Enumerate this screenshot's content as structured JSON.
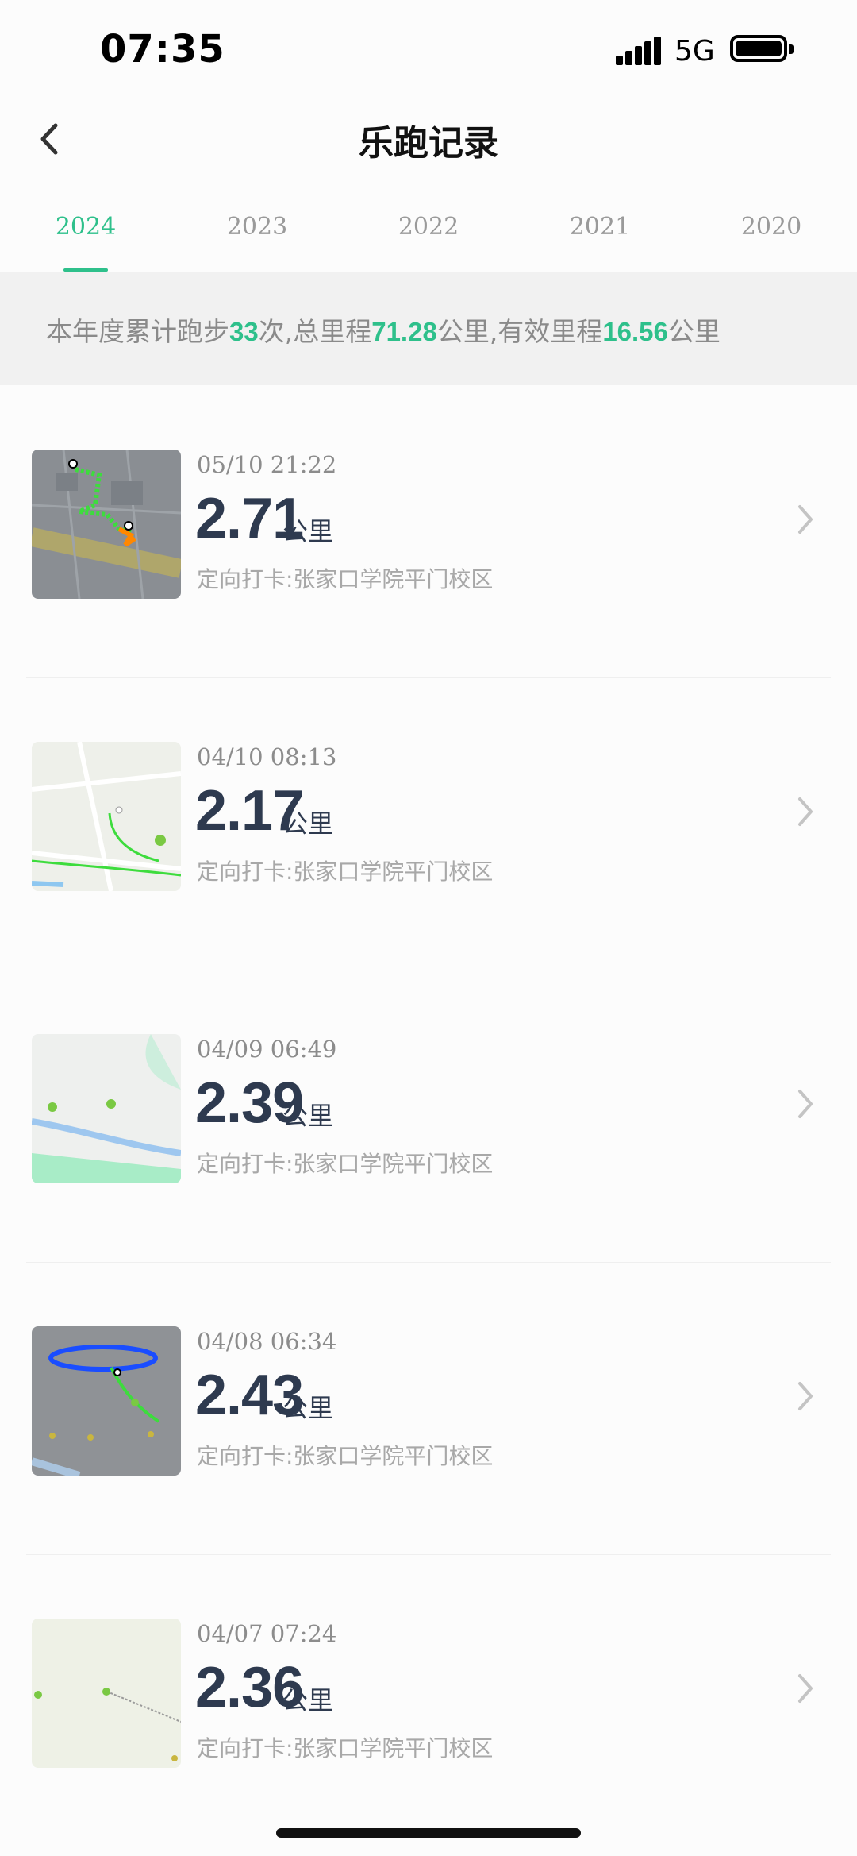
{
  "status": {
    "time": "07:35",
    "network": "5G"
  },
  "nav": {
    "title": "乐跑记录"
  },
  "tabs": [
    {
      "label": "2024",
      "active": true
    },
    {
      "label": "2023",
      "active": false
    },
    {
      "label": "2022",
      "active": false
    },
    {
      "label": "2021",
      "active": false
    },
    {
      "label": "2020",
      "active": false
    }
  ],
  "summary": {
    "prefix": "本年度累计跑步",
    "count": "33",
    "count_suffix": "次,总里程",
    "total": "71.28",
    "total_suffix": "公里,有效里程",
    "valid": "16.56",
    "valid_suffix": "公里"
  },
  "records": [
    {
      "date": "05/10 21:22",
      "distance": "2.71",
      "unit": "公里",
      "place": "定向打卡:张家口学院平门校区",
      "map_icon": "map-thumbnail-dark-route"
    },
    {
      "date": "04/10 08:13",
      "distance": "2.17",
      "unit": "公里",
      "place": "定向打卡:张家口学院平门校区",
      "map_icon": "map-thumbnail-light-route"
    },
    {
      "date": "04/09 06:49",
      "distance": "2.39",
      "unit": "公里",
      "place": "定向打卡:张家口学院平门校区",
      "map_icon": "map-thumbnail-river"
    },
    {
      "date": "04/08 06:34",
      "distance": "2.43",
      "unit": "公里",
      "place": "定向打卡:张家口学院平门校区",
      "map_icon": "map-thumbnail-loop-route"
    },
    {
      "date": "04/07 07:24",
      "distance": "2.36",
      "unit": "公里",
      "place": "定向打卡:张家口学院平门校区",
      "map_icon": "map-thumbnail-plain"
    }
  ],
  "colors": {
    "accent": "#2ec08b",
    "distance": "#2e3a4f",
    "muted": "#a8a8a8"
  }
}
